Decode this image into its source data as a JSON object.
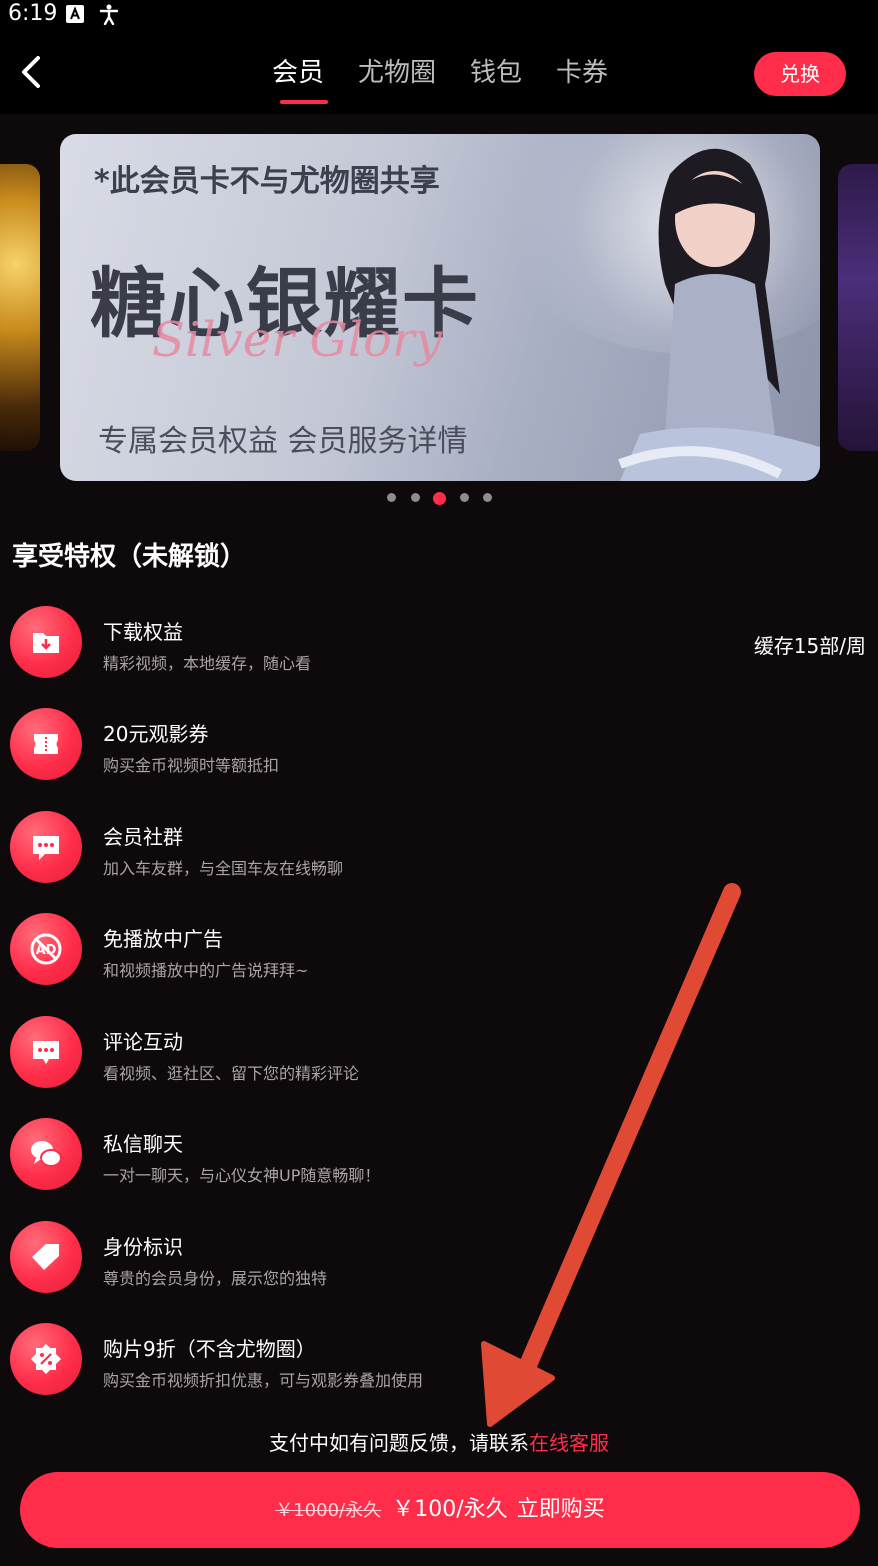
{
  "status_bar": {
    "time": "6:19",
    "icons": [
      "a-letter-icon",
      "accessibility-icon"
    ]
  },
  "nav": {
    "tabs": [
      {
        "label": "会员",
        "active": true
      },
      {
        "label": "尤物圈",
        "active": false
      },
      {
        "label": "钱包",
        "active": false
      },
      {
        "label": "卡券",
        "active": false
      }
    ],
    "redeem_label": "兑换"
  },
  "banner": {
    "note": "*此会员卡不与尤物圈共享",
    "title": "糖心银耀卡",
    "script_text": "Silver Glory",
    "subtitle": "专属会员权益  会员服务详情",
    "slide_count": 5,
    "active_slide": 3
  },
  "perks_section": {
    "title": "享受特权（未解锁）",
    "items": [
      {
        "icon": "download-folder-icon",
        "title": "下载权益",
        "desc": "精彩视频，本地缓存，随心看",
        "extra": "缓存15部/周"
      },
      {
        "icon": "ticket-icon",
        "title": "20元观影券",
        "desc": "购买金币视频时等额抵扣",
        "extra": ""
      },
      {
        "icon": "chat-bubble-icon",
        "title": "会员社群",
        "desc": "加入车友群，与全国车友在线畅聊",
        "extra": ""
      },
      {
        "icon": "no-ads-icon",
        "title": "免播放中广告",
        "desc": "和视频播放中的广告说拜拜~",
        "extra": ""
      },
      {
        "icon": "comment-icon",
        "title": "评论互动",
        "desc": "看视频、逛社区、留下您的精彩评论",
        "extra": ""
      },
      {
        "icon": "private-chat-icon",
        "title": "私信聊天",
        "desc": "一对一聊天，与心仪女神UP随意畅聊！",
        "extra": ""
      },
      {
        "icon": "identity-tag-icon",
        "title": "身份标识",
        "desc": "尊贵的会员身份，展示您的独特",
        "extra": ""
      },
      {
        "icon": "discount-badge-icon",
        "title": "购片9折（不含尤物圈）",
        "desc": "购买金币视频折扣优惠，可与观影券叠加使用",
        "extra": ""
      }
    ]
  },
  "contact": {
    "text": "支付中如有问题反馈，请联系",
    "link_label": "在线客服"
  },
  "purchase": {
    "old_price": "￥1000/永久",
    "price": "￥100/永久",
    "cta": "立即购买"
  },
  "colors": {
    "accent": "#ff2d4a",
    "background": "#0e090b",
    "annotation_arrow": "#e04a35"
  }
}
